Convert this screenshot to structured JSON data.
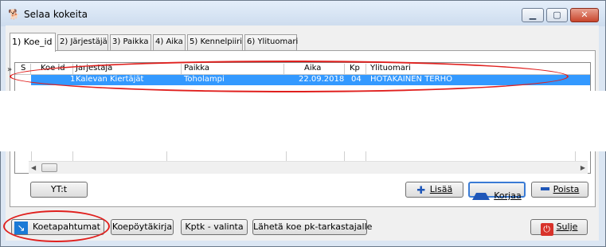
{
  "window": {
    "title": "Selaa kokeita",
    "min_glyph": "▁",
    "max_glyph": "▢",
    "close_glyph": "✕"
  },
  "tabs": [
    {
      "label": "1) Koe_id"
    },
    {
      "label": "2) Järjestäjä"
    },
    {
      "label": "3) Paikka"
    },
    {
      "label": "4) Aika"
    },
    {
      "label": "5) Kennelpiiri"
    },
    {
      "label": "6) Ylituomari"
    }
  ],
  "grid": {
    "row_marker": "»",
    "columns": [
      "S",
      "Koe id",
      "Jarjestaja",
      "Paikka",
      "Aika",
      "Kp",
      "Ylituomari"
    ],
    "rows": [
      {
        "koe_id": "1",
        "jarjestaja": "Kalevan Kiertäjät",
        "paikka": "Toholampi",
        "aika": "22.09.2018",
        "kp": "04",
        "ylituomari": "HOTAKAINEN TERHO"
      }
    ]
  },
  "buttons": {
    "yt": "YT:t",
    "lisaa": "Lisää",
    "korjaa": "Korjaa",
    "poista": "Poista",
    "koetapahtumat": "Koetapahtumat",
    "koepoytakirja": "Koepöytäkirja",
    "kptk_valinta": "Kptk - valinta",
    "laheta": "Lähetä koe pk-tarkastajalle",
    "sulje": "Sulje"
  },
  "colors": {
    "selection": "#3399ff",
    "annotation_red": "#e0201e",
    "accent_blue": "#1e56b8"
  }
}
